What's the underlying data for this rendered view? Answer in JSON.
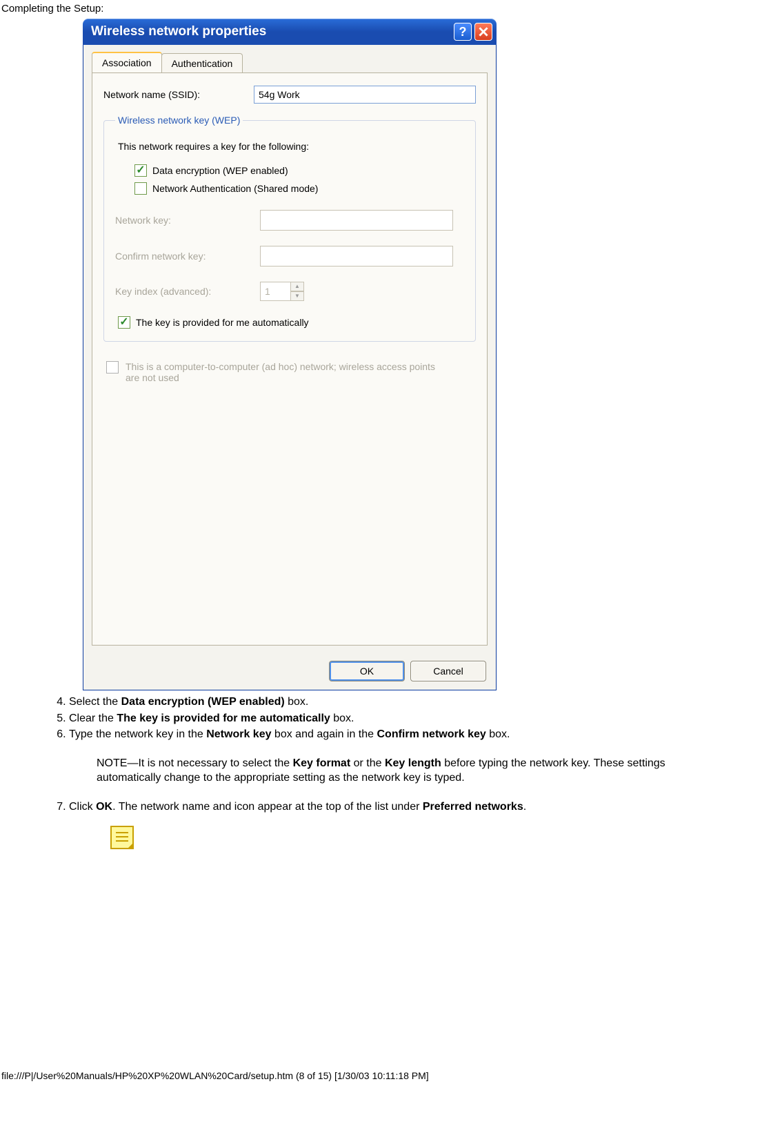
{
  "page": {
    "header": "Completing the Setup:"
  },
  "dialog": {
    "title": "Wireless network properties",
    "tabs": {
      "association": "Association",
      "authentication": "Authentication"
    },
    "ssid": {
      "label": "Network name (SSID):",
      "value": "54g Work"
    },
    "wep": {
      "legend": "Wireless network key (WEP)",
      "requires": "This network requires a key for the following:",
      "cb_encrypt": "Data encryption (WEP enabled)",
      "cb_auth": "Network Authentication (Shared mode)",
      "key_label": "Network key:",
      "confirm_label": "Confirm network key:",
      "index_label": "Key index (advanced):",
      "index_value": "1",
      "auto_label": "The key is provided for me automatically"
    },
    "adhoc": "This is a computer-to-computer (ad hoc) network; wireless access points are not used",
    "buttons": {
      "ok": "OK",
      "cancel": "Cancel"
    }
  },
  "steps": {
    "s4a": "Select the ",
    "s4b": "Data encryption (WEP enabled)",
    "s4c": " box.",
    "s5a": "Clear the ",
    "s5b": "The key is provided for me automatically",
    "s5c": " box.",
    "s6a": "Type the network key in the ",
    "s6b": "Network key",
    "s6c": " box and again in the ",
    "s6d": "Confirm network key",
    "s6e": " box.",
    "note_a": "NOTE—It is not necessary to select the ",
    "note_b": "Key format",
    "note_c": " or the ",
    "note_d": "Key length",
    "note_e": " before typing the network key. These settings automatically change to the appropriate setting as the network key is typed.",
    "s7a": "Click ",
    "s7b": "OK",
    "s7c": ". The network name and icon appear at the top of the list under ",
    "s7d": "Preferred networks",
    "s7e": "."
  },
  "footer": "file:///P|/User%20Manuals/HP%20XP%20WLAN%20Card/setup.htm (8 of 15) [1/30/03 10:11:18 PM]"
}
